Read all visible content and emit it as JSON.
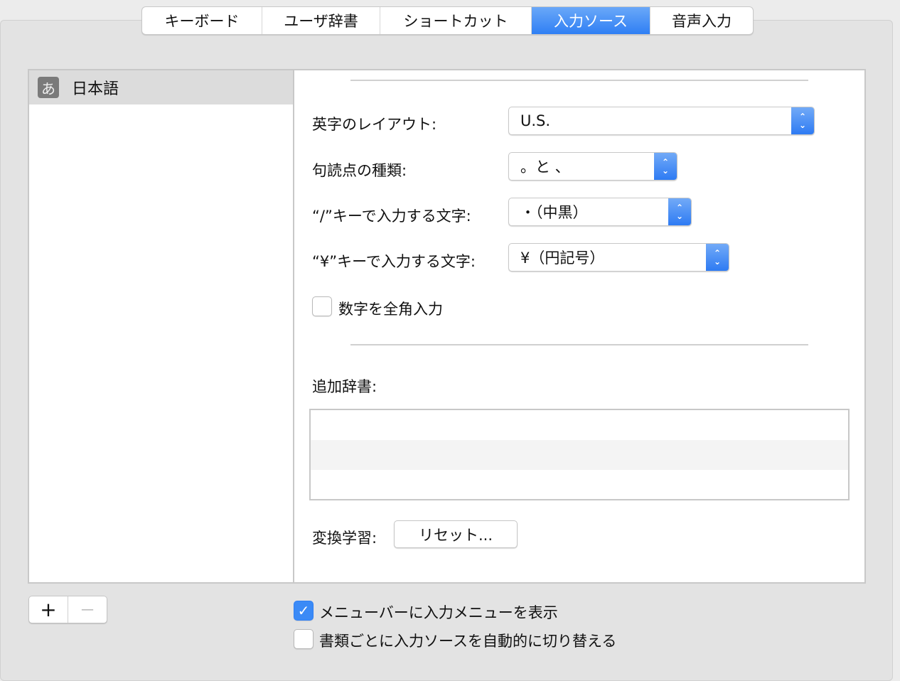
{
  "tabs": [
    {
      "label": "キーボード"
    },
    {
      "label": "ユーザ辞書"
    },
    {
      "label": "ショートカット"
    },
    {
      "label": "入力ソース",
      "selected": true
    },
    {
      "label": "音声入力"
    }
  ],
  "sources": {
    "selected_icon": "あ",
    "selected_label": "日本語"
  },
  "settings": {
    "layout_label": "英字のレイアウト:",
    "layout_value": "U.S.",
    "punct_label": "句読点の種類:",
    "punct_value": "。と 、",
    "slash_label": "“/”キーで入力する文字:",
    "slash_value": "・（中黒）",
    "yen_label": "“¥”キーで入力する文字:",
    "yen_value": "¥（円記号）",
    "fullwidth_label": "数字を全角入力",
    "fullwidth_checked": false,
    "dict_label": "追加辞書:",
    "learning_label": "変換学習:",
    "reset_label": "リセット..."
  },
  "bottom": {
    "add": "+",
    "remove": "—",
    "show_menu_label": "メニューバーに入力メニューを表示",
    "show_menu_checked": true,
    "auto_switch_label": "書類ごとに入力ソースを自動的に切り替える",
    "auto_switch_checked": false
  },
  "colors": {
    "accent": "#3b8af6"
  }
}
